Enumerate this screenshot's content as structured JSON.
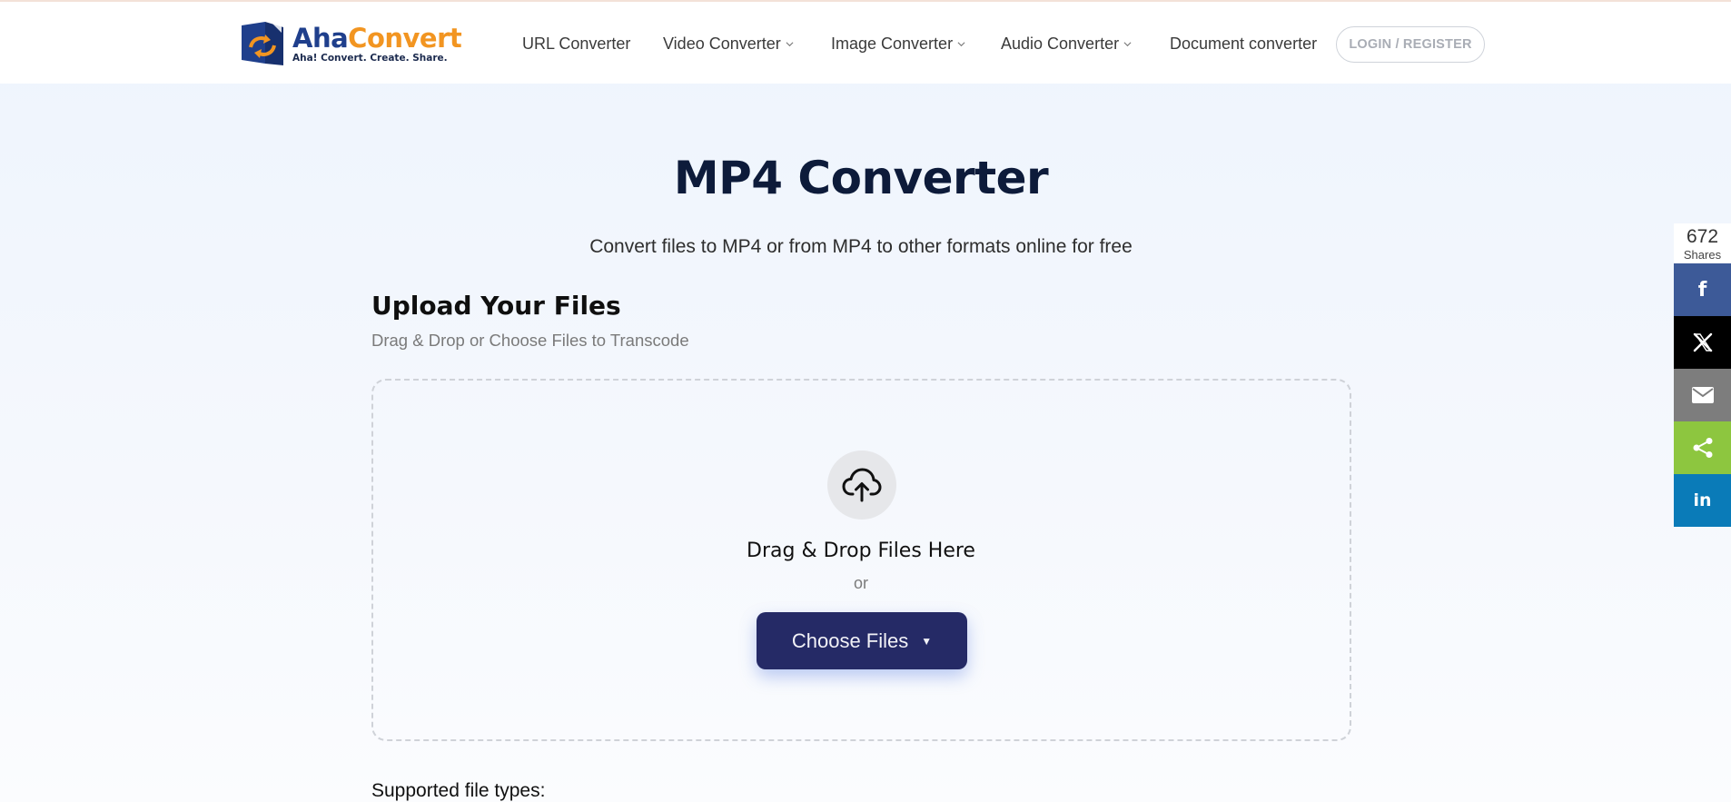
{
  "brand": {
    "name_part1": "Aha",
    "name_part2": "Convert",
    "tagline": "Aha! Convert. Create. Share.",
    "colors": {
      "primary": "#1f3f8c",
      "accent": "#f29521"
    }
  },
  "nav": {
    "items": [
      {
        "label": "URL Converter",
        "has_dropdown": false
      },
      {
        "label": "Video Converter",
        "has_dropdown": true
      },
      {
        "label": "Image Converter",
        "has_dropdown": true
      },
      {
        "label": "Audio Converter",
        "has_dropdown": true
      },
      {
        "label": "Document converter",
        "has_dropdown": false
      }
    ],
    "login_label": "LOGIN / REGISTER"
  },
  "hero": {
    "title": "MP4 Converter",
    "subtitle": "Convert files to MP4 or from MP4 to other formats online for free"
  },
  "upload": {
    "heading": "Upload Your Files",
    "subheading": "Drag & Drop or Choose Files to Transcode",
    "icon": "cloud-upload-icon",
    "drop_text": "Drag & Drop Files Here",
    "or_text": "or",
    "button_label": "Choose Files",
    "button_color": "#252a66",
    "supported_label": "Supported file types:"
  },
  "share": {
    "count": "672",
    "count_label": "Shares",
    "buttons": [
      {
        "network": "facebook",
        "icon": "facebook-icon",
        "glyph": "f",
        "color": "#3d5a98"
      },
      {
        "network": "x",
        "icon": "x-icon",
        "glyph": "𝕏",
        "color": "#000000"
      },
      {
        "network": "email",
        "icon": "email-icon",
        "glyph": "",
        "color": "#7d7d7d"
      },
      {
        "network": "share",
        "icon": "share-icon",
        "glyph": "",
        "color": "#8dc63f"
      },
      {
        "network": "linkedin",
        "icon": "linkedin-icon",
        "glyph": "in",
        "color": "#0a7bb8"
      }
    ]
  }
}
